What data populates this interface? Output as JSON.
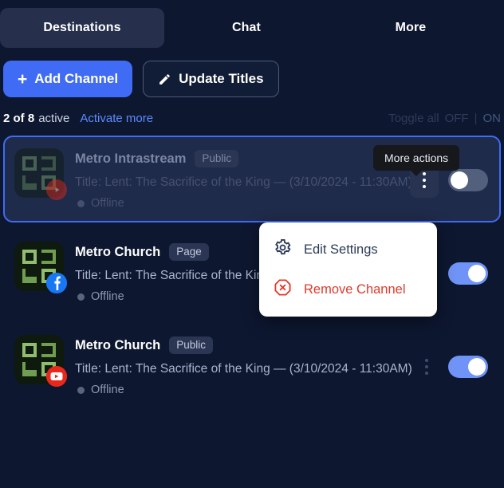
{
  "tabs": [
    {
      "label": "Destinations",
      "active": true
    },
    {
      "label": "Chat",
      "active": false
    },
    {
      "label": "More",
      "active": false
    }
  ],
  "toolbar": {
    "add_channel_label": "Add Channel",
    "add_channel_icon": "plus-icon",
    "update_titles_label": "Update Titles",
    "update_titles_icon": "pencil-icon"
  },
  "status": {
    "count": "2 of 8",
    "active_word": "active",
    "activate_more_link": "Activate more",
    "toggle_all_label": "Toggle all",
    "toggle_all_off": "OFF",
    "toggle_all_separator": "|",
    "toggle_all_on": "ON"
  },
  "tooltip": {
    "text": "More actions"
  },
  "menu": {
    "items": [
      {
        "label": "Edit Settings",
        "icon": "gear-icon",
        "variant": "default"
      },
      {
        "label": "Remove Channel",
        "icon": "remove-octagon-icon",
        "variant": "danger"
      }
    ]
  },
  "channels": [
    {
      "name": "Metro Intrastream",
      "badge": "Public",
      "title": "Title: Lent: The Sacrifice of the King — (3/10/2024 - 11:30AM)",
      "status": "Offline",
      "platform": "youtube",
      "toggle": "off",
      "selected": true
    },
    {
      "name": "Metro Church",
      "badge": "Page",
      "title": "Title: Lent: The Sacrifice of the King — (3/10/2024 - 11:30AM)",
      "status": "Offline",
      "platform": "facebook",
      "toggle": "on",
      "selected": false
    },
    {
      "name": "Metro Church",
      "badge": "Public",
      "title": "Title: Lent: The Sacrifice of the King — (3/10/2024 - 11:30AM)",
      "status": "Offline",
      "platform": "youtube",
      "toggle": "on",
      "selected": false
    }
  ],
  "colors": {
    "background": "#0d1730",
    "accent_blue": "#3f6bf5",
    "selected_card_bg": "#1f2b4a",
    "danger_red": "#e0392b",
    "toggle_on": "#6f93f7",
    "toggle_off": "#525f7d",
    "facebook": "#1877f2",
    "youtube": "#e8281c"
  }
}
